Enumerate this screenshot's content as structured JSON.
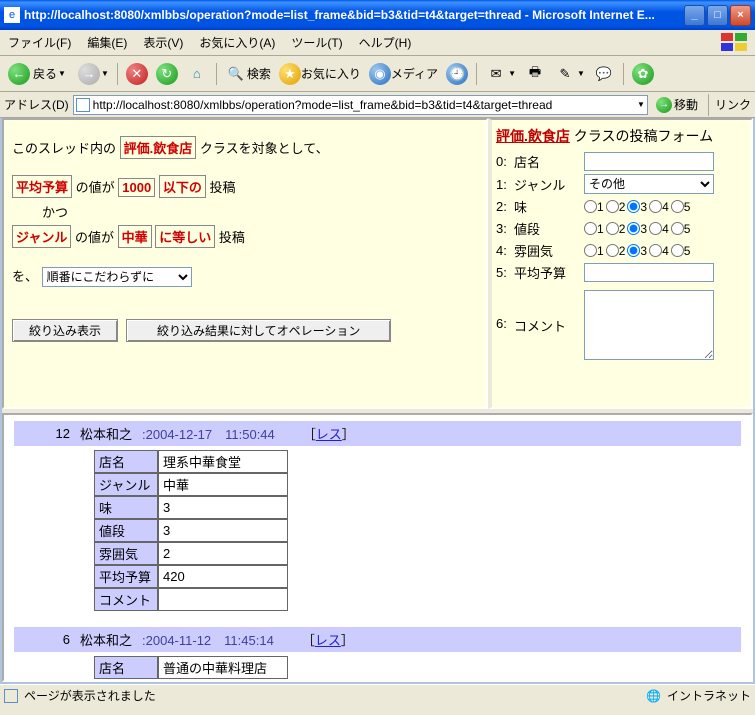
{
  "window": {
    "title": "http://localhost:8080/xmlbbs/operation?mode=list_frame&bid=b3&tid=t4&target=thread - Microsoft Internet E..."
  },
  "menu": {
    "file": "ファイル(F)",
    "edit": "編集(E)",
    "view": "表示(V)",
    "fav": "お気に入り(A)",
    "tools": "ツール(T)",
    "help": "ヘルプ(H)"
  },
  "toolbar": {
    "back": "戻る",
    "search": "検索",
    "favorites": "お気に入り",
    "media": "メディア"
  },
  "address": {
    "label": "アドレス(D)",
    "url": "http://localhost:8080/xmlbbs/operation?mode=list_frame&bid=b3&tid=t4&target=thread",
    "go": "移動",
    "links": "リンク"
  },
  "left": {
    "l1a": "このスレッド内の",
    "l1b": "評価.飲食店",
    "l1c": "クラスを対象として、",
    "l2a": "平均予算",
    "l2b": "の値が",
    "l2c": "1000",
    "l2d": "以下の",
    "l2e": "投稿",
    "l3": "かつ",
    "l4a": "ジャンル",
    "l4b": "の値が",
    "l4c": "中華",
    "l4d": "に等しい",
    "l4e": "投稿",
    "l5": "を、",
    "sort": "順番にこだわらずに",
    "btn1": "絞り込み表示",
    "btn2": "絞り込み結果に対してオペレーション"
  },
  "right": {
    "title_a": "評価.飲食店",
    "title_b": " クラスの投稿フォーム",
    "rows": [
      {
        "idx": "0:",
        "lbl": "店名"
      },
      {
        "idx": "1:",
        "lbl": "ジャンル"
      },
      {
        "idx": "2:",
        "lbl": "味"
      },
      {
        "idx": "3:",
        "lbl": "値段"
      },
      {
        "idx": "4:",
        "lbl": "雰囲気"
      },
      {
        "idx": "5:",
        "lbl": "平均予算"
      },
      {
        "idx": "6:",
        "lbl": "コメント"
      }
    ],
    "genre_selected": "その他",
    "radio_vals": [
      "1",
      "2",
      "3",
      "4",
      "5"
    ]
  },
  "posts": [
    {
      "num": "12",
      "author": "松本和之",
      "time": ":2004-12-17　11:50:44",
      "res": "レス",
      "rows": [
        {
          "k": "店名",
          "v": "理系中華食堂"
        },
        {
          "k": "ジャンル",
          "v": "中華"
        },
        {
          "k": "味",
          "v": "3"
        },
        {
          "k": "値段",
          "v": "3"
        },
        {
          "k": "雰囲気",
          "v": "2"
        },
        {
          "k": "平均予算",
          "v": "420"
        },
        {
          "k": "コメント",
          "v": ""
        }
      ]
    },
    {
      "num": "6",
      "author": "松本和之",
      "time": ":2004-11-12　11:45:14",
      "res": "レス",
      "rows": [
        {
          "k": "店名",
          "v": "普通の中華料理店"
        }
      ]
    }
  ],
  "status": {
    "text": "ページが表示されました",
    "zone": "イントラネット"
  }
}
